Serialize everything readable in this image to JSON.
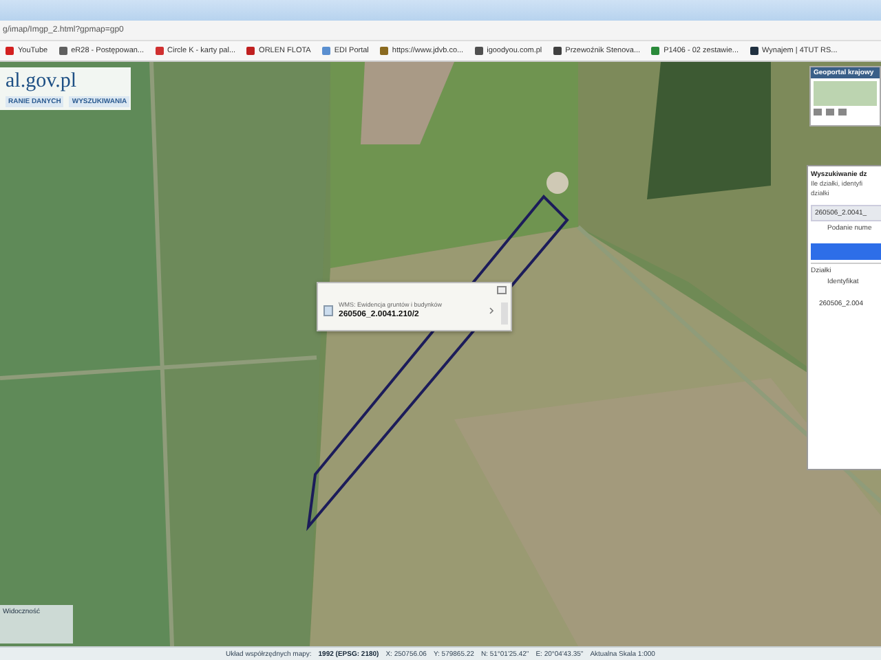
{
  "browser": {
    "url": "g/imap/Imgp_2.html?gpmap=gp0",
    "bookmarks": [
      {
        "label": "YouTube",
        "color": "#d32020"
      },
      {
        "label": "eR28 - Postępowan...",
        "color": "#606060"
      },
      {
        "label": "Circle K - karty pal...",
        "color": "#d03030"
      },
      {
        "label": "ORLEN FLOTA",
        "color": "#c02020"
      },
      {
        "label": "EDI Portal",
        "color": "#5a8fd0"
      },
      {
        "label": "https://www.jdvb.co...",
        "color": "#8a6a20"
      },
      {
        "label": "igoodyou.com.pl",
        "color": "#505050"
      },
      {
        "label": "Przewoźnik Stenova...",
        "color": "#404040"
      },
      {
        "label": "P1406 - 02 zestawie...",
        "color": "#2a8a3a"
      },
      {
        "label": "Wynajem | 4TUT RS...",
        "color": "#203040"
      }
    ]
  },
  "header": {
    "logo": "al.gov.pl",
    "nav": [
      {
        "label": "RANIE DANYCH"
      },
      {
        "label": "WYSZUKIWANIA"
      }
    ]
  },
  "overview": {
    "title": "Geoportal krajowy"
  },
  "popup": {
    "layer": "WMS: Ewidencja gruntów i budynków",
    "parcel": "260506_2.0041.210/2"
  },
  "search_panel": {
    "title": "Wyszukiwanie dz",
    "hint": "Ile działki, identyfi",
    "hint_2": "działki",
    "field_value": "260506_2.0041_",
    "field_label": "Podanie nume",
    "section": "Działki",
    "column": "Identyfikat",
    "result": "260506_2.004"
  },
  "legend": {
    "items": [
      "Widoczność"
    ]
  },
  "status_bar": {
    "crs_label": "Układ współrzędnych mapy:",
    "crs": "1992 (EPSG: 2180)",
    "x": "X: 250756.06",
    "y": "Y: 579865.22",
    "n": "N: 51°01'25.42\"",
    "e": "E: 20°04'43.35\"",
    "scale": "Aktualna Skala 1:000"
  }
}
